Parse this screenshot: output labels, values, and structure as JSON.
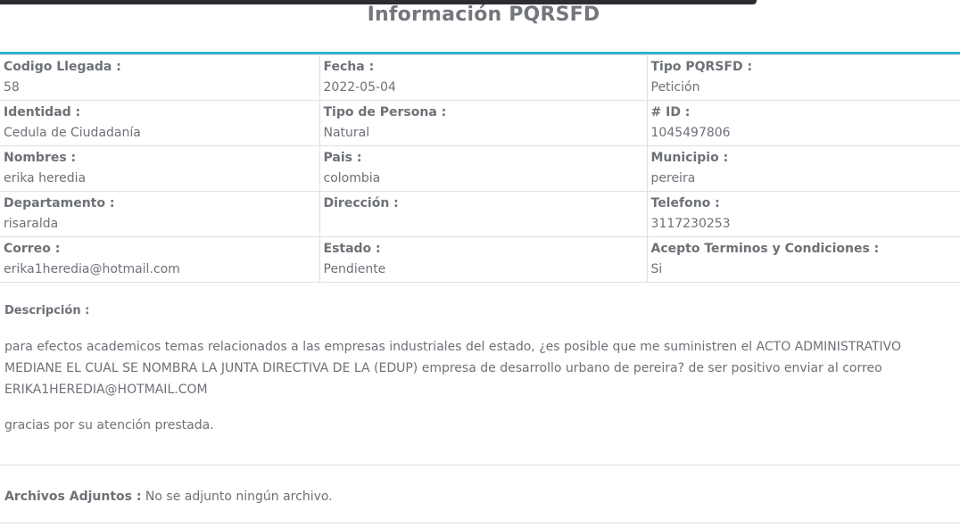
{
  "title": "Información PQRSFD",
  "fields": [
    [
      {
        "label": "Codigo Llegada :",
        "value": "58"
      },
      {
        "label": "Fecha :",
        "value": "2022-05-04"
      },
      {
        "label": "Tipo PQRSFD :",
        "value": "Petición"
      }
    ],
    [
      {
        "label": "Identidad :",
        "value": "Cedula de Ciudadanía"
      },
      {
        "label": "Tipo de Persona :",
        "value": "Natural"
      },
      {
        "label": "# ID :",
        "value": "1045497806"
      }
    ],
    [
      {
        "label": "Nombres :",
        "value": "erika heredia"
      },
      {
        "label": "Pais :",
        "value": "colombia"
      },
      {
        "label": "Municipio :",
        "value": "pereira"
      }
    ],
    [
      {
        "label": "Departamento :",
        "value": "risaralda"
      },
      {
        "label": "Dirección :",
        "value": ""
      },
      {
        "label": "Telefono :",
        "value": "3117230253"
      }
    ],
    [
      {
        "label": "Correo :",
        "value": "erika1heredia@hotmail.com"
      },
      {
        "label": "Estado :",
        "value": "Pendiente"
      },
      {
        "label": "Acepto Terminos y Condiciones :",
        "value": "Si"
      }
    ]
  ],
  "description": {
    "label": "Descripción :",
    "paragraph1": "para efectos academicos temas relacionados a las empresas industriales del estado, ¿es posible que me suministren el ACTO ADMINISTRATIVO MEDIANE EL CUAL SE NOMBRA LA JUNTA DIRECTIVA DE LA (EDUP) empresa de desarrollo urbano de pereira? de ser positivo enviar al correo ERIKA1HEREDIA@HOTMAIL.COM",
    "paragraph2": "gracias por su atención prestada."
  },
  "attachments": {
    "label": "Archivos Adjuntos :",
    "value": "No se adjunto ningún archivo."
  },
  "colors": {
    "accent": "#2fb5cf",
    "text": "#6d7177",
    "border": "#dde0e4"
  }
}
